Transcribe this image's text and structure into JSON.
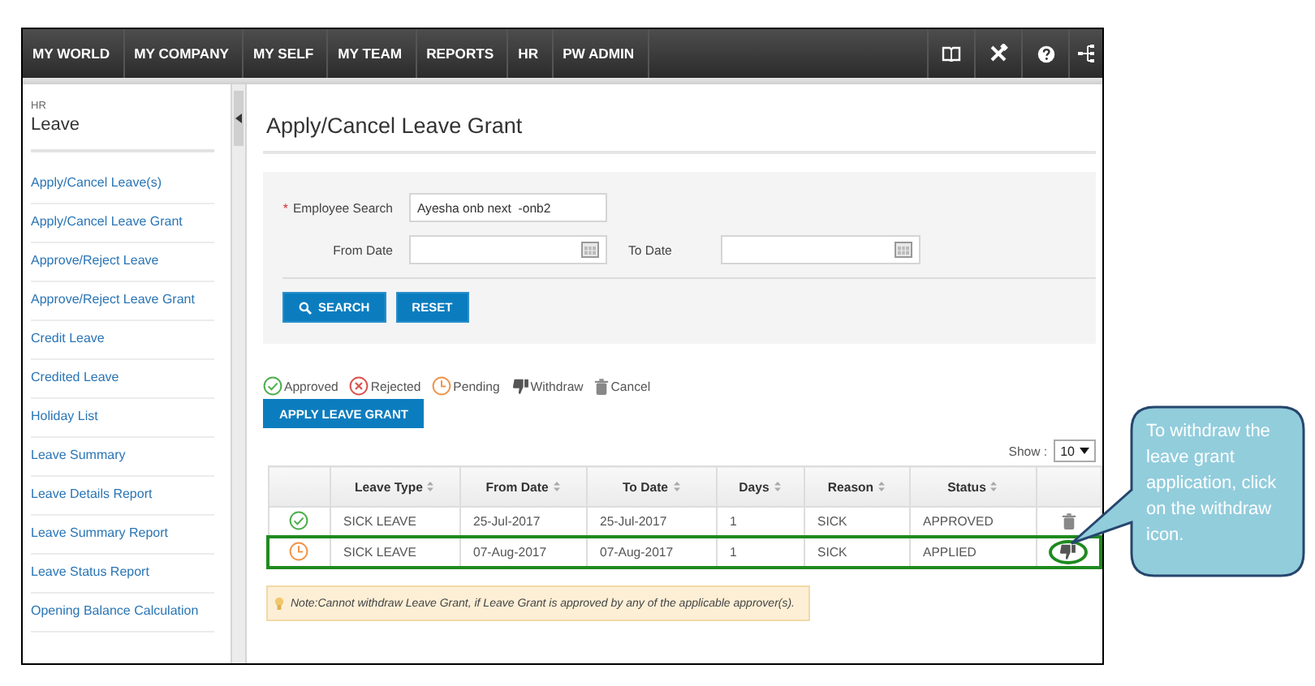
{
  "nav": {
    "items": [
      {
        "label": "MY WORLD"
      },
      {
        "label": "MY COMPANY"
      },
      {
        "label": "MY SELF"
      },
      {
        "label": "MY TEAM"
      },
      {
        "label": "REPORTS"
      },
      {
        "label": "HR"
      },
      {
        "label": "PW ADMIN"
      }
    ]
  },
  "sidebar": {
    "section": "HR",
    "title": "Leave",
    "items": [
      {
        "label": "Apply/Cancel Leave(s)"
      },
      {
        "label": "Apply/Cancel Leave Grant"
      },
      {
        "label": "Approve/Reject Leave"
      },
      {
        "label": "Approve/Reject Leave Grant"
      },
      {
        "label": "Credit Leave"
      },
      {
        "label": "Credited Leave"
      },
      {
        "label": "Holiday List"
      },
      {
        "label": "Leave Summary"
      },
      {
        "label": "Leave Details Report"
      },
      {
        "label": "Leave Summary Report"
      },
      {
        "label": "Leave Status Report"
      },
      {
        "label": "Opening Balance Calculation"
      }
    ]
  },
  "page": {
    "title": "Apply/Cancel Leave Grant"
  },
  "search_form": {
    "required_mark": "*",
    "employee_label": "Employee Search",
    "employee_value": "Ayesha onb next  -onb2",
    "from_label": "From Date",
    "to_label": "To Date",
    "buttons": [
      {
        "label": "SEARCH",
        "kind": "search"
      },
      {
        "label": "RESET",
        "kind": "plain"
      }
    ]
  },
  "legend": [
    {
      "kind": "approved",
      "label": "Approved"
    },
    {
      "kind": "rejected",
      "label": "Rejected"
    },
    {
      "kind": "pending",
      "label": "Pending"
    },
    {
      "kind": "withdraw",
      "label": "Withdraw"
    },
    {
      "kind": "cancel",
      "label": "Cancel"
    }
  ],
  "apply_button": "APPLY LEAVE GRANT",
  "page_size": {
    "label": "Show :",
    "value": "10"
  },
  "table": {
    "columns": [
      "Leave Type",
      "From Date",
      "To Date",
      "Days",
      "Reason",
      "Status"
    ],
    "rows": [
      {
        "status_icon": {
          "kind": "approved"
        },
        "cells": [
          "SICK LEAVE",
          "25-Jul-2017",
          "25-Jul-2017",
          "1",
          "SICK",
          "APPROVED"
        ],
        "action_button": {
          "kind": "cancel",
          "circled": false
        },
        "highlighted": false
      },
      {
        "status_icon": {
          "kind": "pending"
        },
        "cells": [
          "SICK LEAVE",
          "07-Aug-2017",
          "07-Aug-2017",
          "1",
          "SICK",
          "APPLIED"
        ],
        "action_button": {
          "kind": "withdraw",
          "circled": true
        },
        "highlighted": true
      }
    ]
  },
  "note": "Note:Cannot withdraw Leave Grant, if Leave Grant is approved by any of the applicable approver(s).",
  "callout": {
    "text": "To withdraw the leave grant application, click on the withdraw icon."
  }
}
